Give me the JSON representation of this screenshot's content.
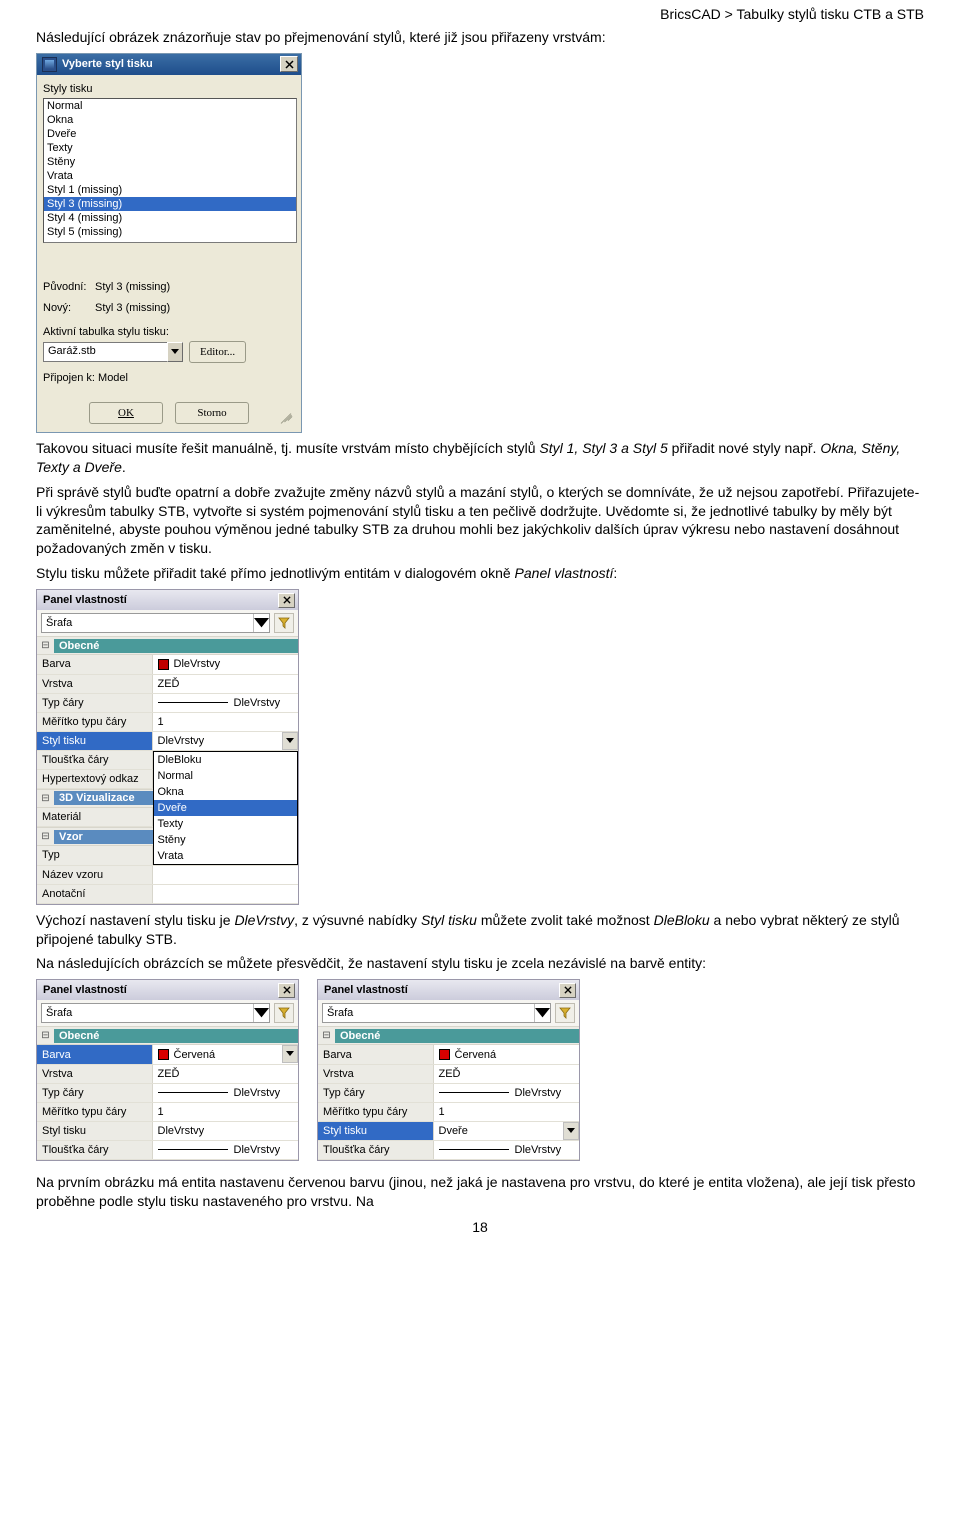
{
  "breadcrumb": "BricsCAD > Tabulky stylů tisku CTB a STB",
  "intro": "Následující obrázek znázorňuje stav po přejmenování stylů, které již jsou přiřazeny vrstvám:",
  "dlg1": {
    "title": "Vyberte styl tisku",
    "sectionLabel": "Styly tisku",
    "items": [
      "Normal",
      "Okna",
      "Dveře",
      "Texty",
      "Stěny",
      "Vrata",
      "Styl 1 (missing)",
      "Styl 3 (missing)",
      "Styl 4 (missing)",
      "Styl 5 (missing)"
    ],
    "selectedIndex": 7,
    "origLabel": "Původní:",
    "origVal": "Styl 3 (missing)",
    "newLabel": "Nový:",
    "newVal": "Styl 3 (missing)",
    "activeTable": "Aktivní tabulka stylu tisku:",
    "combo": "Garáž.stb",
    "editorBtn": "Editor...",
    "attachedLabel": "Připojen k: Model",
    "ok": "OK",
    "cancel": "Storno"
  },
  "para1a": "Takovou situaci musíte řešit manuálně, tj. musíte vrstvám místo chybějících stylů ",
  "para1b": " přiřadit nové styly např. ",
  "para1c": ".",
  "missing": "Styl 1, Styl 3 a Styl 5",
  "newnames": "Okna, Stěny, Texty a Dveře",
  "para2": "Při správě stylů buďte opatrní a dobře zvažujte změny názvů stylů a mazání stylů, o kterých se domníváte, že už nejsou zapotřebí. Přiřazujete-li výkresům tabulky STB, vytvořte si systém pojmenování stylů tisku a ten pečlivě dodržujte. Uvědomte si, že jednotlivé tabulky by měly být zaměnitelné, abyste pouhou výměnou jedné tabulky STB za druhou mohli bez jakýchkoliv dalších úprav výkresu nebo nastavení dosáhnout požadovaných změn v tisku.",
  "para3a": "Stylu tisku můžete přiřadit také přímo jednotlivým entitám v dialogovém okně ",
  "para3b": ":",
  "panelTitle": "Panel vlastností",
  "panel2": {
    "entity": "Šrafa",
    "secGeneral": "Obecné",
    "sec3d": "3D Vizualizace",
    "secPattern": "Vzor",
    "rows": {
      "color": {
        "k": "Barva",
        "v": "DleVrstvy",
        "swatch": "#c00000"
      },
      "layer": {
        "k": "Vrstva",
        "v": "ZEĎ"
      },
      "ltype": {
        "k": "Typ čáry",
        "v": "DleVrstvy"
      },
      "ltscale": {
        "k": "Měřítko typu čáry",
        "v": "1"
      },
      "style": {
        "k": "Styl tisku",
        "v": "DleVrstvy"
      },
      "lweight": {
        "k": "Tloušťka čáry",
        "v": "DleVrstvy"
      },
      "hyper": {
        "k": "Hypertextový odkaz",
        "v": ""
      },
      "material": {
        "k": "Materiál",
        "v": ""
      },
      "type": {
        "k": "Typ",
        "v": ""
      },
      "pname": {
        "k": "Název vzoru",
        "v": ""
      },
      "annot": {
        "k": "Anotační",
        "v": ""
      }
    },
    "ddoptions": [
      "DleBloku",
      "Normal",
      "Okna",
      "Dveře",
      "Texty",
      "Stěny",
      "Vrata"
    ],
    "ddsel": 3
  },
  "para4a": "Výchozí nastavení stylu tisku je ",
  "para4b": ", z výsuvné nabídky ",
  "para4c": " můžete zvolit také možnost ",
  "para4d": " a nebo vybrat některý ze stylů připojené tabulky STB.",
  "defStyle": "DleVrstvy",
  "stylMenu": "Styl tisku",
  "dleBloku": "DleBloku",
  "para5": "Na následujících obrázcích se můžete přesvědčit, že nastavení stylu tisku je zcela nezávislé na barvě entity:",
  "panel3": {
    "entity": "Šrafa",
    "rows": {
      "color": {
        "k": "Barva",
        "v": "Červená",
        "swatch": "#d80000"
      },
      "layer": {
        "k": "Vrstva",
        "v": "ZEĎ"
      },
      "ltype": {
        "k": "Typ čáry",
        "v": "DleVrstvy"
      },
      "ltscale": {
        "k": "Měřítko typu čáry",
        "v": "1"
      },
      "style": {
        "k": "Styl tisku",
        "v": "DleVrstvy"
      },
      "lweight": {
        "k": "Tloušťka čáry",
        "v": "DleVrstvy"
      }
    }
  },
  "panel4": {
    "entity": "Šrafa",
    "rows": {
      "color": {
        "k": "Barva",
        "v": "Červená",
        "swatch": "#d80000"
      },
      "layer": {
        "k": "Vrstva",
        "v": "ZEĎ"
      },
      "ltype": {
        "k": "Typ čáry",
        "v": "DleVrstvy"
      },
      "ltscale": {
        "k": "Měřítko typu čáry",
        "v": "1"
      },
      "style": {
        "k": "Styl tisku",
        "v": "Dveře"
      },
      "lweight": {
        "k": "Tloušťka čáry",
        "v": "DleVrstvy"
      }
    }
  },
  "para6": "Na prvním obrázku má entita nastavenu červenou barvu (jinou, než jaká je nastavena pro vrstvu, do které je entita vložena), ale její tisk přesto proběhne podle stylu tisku nastaveného pro vrstvu. Na",
  "pageNum": "18"
}
